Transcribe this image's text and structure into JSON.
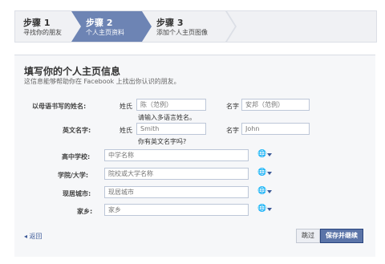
{
  "steps": [
    {
      "title": "步骤 1",
      "sub": "寻找你的朋友"
    },
    {
      "title": "步骤 2",
      "sub": "个人主页资料"
    },
    {
      "title": "步骤 3",
      "sub": "添加个人主页图像"
    }
  ],
  "header": {
    "title": "填写你的个人主页信息",
    "subtitle": "这信息能够帮助你在 Facebook 上找出你认识的朋友。"
  },
  "form": {
    "native_name_label": "以母语书写的姓名:",
    "english_name_label": "英文名字:",
    "surname_label": "姓氏",
    "given_label": "名字",
    "native_surname_placeholder": "陈（范例）",
    "native_given_placeholder": "安邦（范例）",
    "native_hint": "请输入多语言姓名。",
    "english_surname_placeholder": "Smith",
    "english_given_placeholder": "John",
    "english_hint": "你有英文名字吗?",
    "high_school_label": "高中学校:",
    "high_school_placeholder": "中学名称",
    "college_label": "学院/大学:",
    "college_placeholder": "院校或大学名称",
    "city_label": "现居城市:",
    "city_placeholder": "现居城市",
    "hometown_label": "家乡:",
    "hometown_placeholder": "家乡"
  },
  "footer": {
    "back": "◂ 返回",
    "skip": "跳过",
    "save": "保存并继续"
  }
}
